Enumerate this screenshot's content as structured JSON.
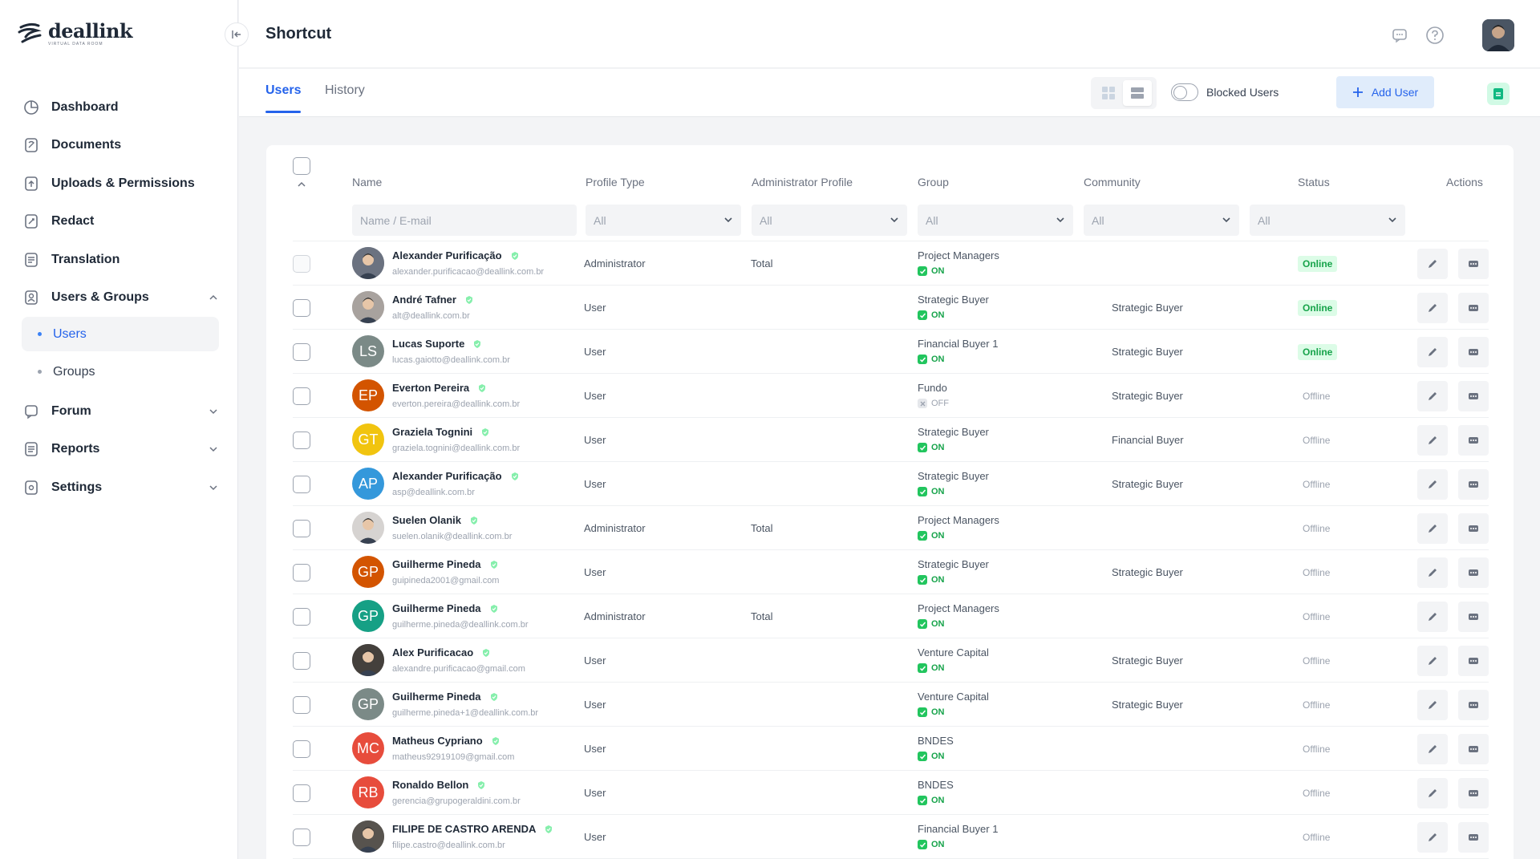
{
  "app": {
    "logo_text": "deallink",
    "logo_subtext": "VIRTUAL DATA ROOM"
  },
  "sidebar": {
    "items": [
      {
        "label": "Dashboard",
        "icon": "dashboard-icon"
      },
      {
        "label": "Documents",
        "icon": "documents-icon"
      },
      {
        "label": "Uploads & Permissions",
        "icon": "upload-icon"
      },
      {
        "label": "Redact",
        "icon": "redact-icon"
      },
      {
        "label": "Translation",
        "icon": "translation-icon"
      },
      {
        "label": "Users & Groups",
        "icon": "users-icon",
        "expanded": true
      },
      {
        "label": "Forum",
        "icon": "forum-icon"
      },
      {
        "label": "Reports",
        "icon": "reports-icon"
      },
      {
        "label": "Settings",
        "icon": "settings-icon"
      }
    ],
    "subitems": [
      {
        "label": "Users",
        "active": true
      },
      {
        "label": "Groups",
        "active": false
      }
    ]
  },
  "header": {
    "title": "Shortcut"
  },
  "tabs": [
    {
      "label": "Users",
      "active": true
    },
    {
      "label": "History",
      "active": false
    }
  ],
  "toolbar": {
    "blocked_users_label": "Blocked Users",
    "add_user_label": "Add User"
  },
  "table": {
    "columns": {
      "name": "Name",
      "profile_type": "Profile Type",
      "admin_profile": "Administrator Profile",
      "group": "Group",
      "community": "Community",
      "status": "Status",
      "actions": "Actions"
    },
    "filters": {
      "name_placeholder": "Name / E-mail",
      "profile_type": "All",
      "admin_profile": "All",
      "group": "All",
      "community": "All",
      "status": "All"
    },
    "rows": [
      {
        "name": "Alexander Purificação",
        "email": "alexander.purificacao@deallink.com.br",
        "avatar": "photo",
        "initials": "",
        "avatar_color": "#6b7280",
        "profile": "Administrator",
        "admin": "Total",
        "group": "Project Managers",
        "group_state": "ON",
        "community": "",
        "status": "Online"
      },
      {
        "name": "André Tafner",
        "email": "alt@deallink.com.br",
        "avatar": "photo",
        "initials": "",
        "avatar_color": "#a8a29e",
        "profile": "User",
        "admin": "",
        "group": "Strategic Buyer",
        "group_state": "ON",
        "community": "Strategic Buyer",
        "status": "Online"
      },
      {
        "name": "Lucas Suporte",
        "email": "lucas.gaiotto@deallink.com.br",
        "avatar": "initials",
        "initials": "LS",
        "avatar_color": "#7b8a87",
        "profile": "User",
        "admin": "",
        "group": "Financial Buyer 1",
        "group_state": "ON",
        "community": "Strategic Buyer",
        "status": "Online"
      },
      {
        "name": "Everton Pereira",
        "email": "everton.pereira@deallink.com.br",
        "avatar": "initials",
        "initials": "EP",
        "avatar_color": "#d35400",
        "profile": "User",
        "admin": "",
        "group": "Fundo",
        "group_state": "OFF",
        "community": "Strategic Buyer",
        "status": "Offline"
      },
      {
        "name": "Graziela Tognini",
        "email": "graziela.tognini@deallink.com.br",
        "avatar": "initials",
        "initials": "GT",
        "avatar_color": "#f1c40f",
        "profile": "User",
        "admin": "",
        "group": "Strategic Buyer",
        "group_state": "ON",
        "community": "Financial Buyer",
        "status": "Offline"
      },
      {
        "name": "Alexander Purificação",
        "email": "asp@deallink.com.br",
        "avatar": "initials",
        "initials": "AP",
        "avatar_color": "#3498db",
        "profile": "User",
        "admin": "",
        "group": "Strategic Buyer",
        "group_state": "ON",
        "community": "Strategic Buyer",
        "status": "Offline"
      },
      {
        "name": "Suelen Olanik",
        "email": "suelen.olanik@deallink.com.br",
        "avatar": "photo",
        "initials": "",
        "avatar_color": "#d6d3d1",
        "profile": "Administrator",
        "admin": "Total",
        "group": "Project Managers",
        "group_state": "ON",
        "community": "",
        "status": "Offline"
      },
      {
        "name": "Guilherme Pineda",
        "email": "guipineda2001@gmail.com",
        "avatar": "initials",
        "initials": "GP",
        "avatar_color": "#d35400",
        "profile": "User",
        "admin": "",
        "group": "Strategic Buyer",
        "group_state": "ON",
        "community": "Strategic Buyer",
        "status": "Offline"
      },
      {
        "name": "Guilherme Pineda",
        "email": "guilherme.pineda@deallink.com.br",
        "avatar": "initials",
        "initials": "GP",
        "avatar_color": "#16a085",
        "profile": "Administrator",
        "admin": "Total",
        "group": "Project Managers",
        "group_state": "ON",
        "community": "",
        "status": "Offline"
      },
      {
        "name": "Alex Purificacao",
        "email": "alexandre.purificacao@gmail.com",
        "avatar": "photo",
        "initials": "",
        "avatar_color": "#44403c",
        "profile": "User",
        "admin": "",
        "group": "Venture Capital",
        "group_state": "ON",
        "community": "Strategic Buyer",
        "status": "Offline"
      },
      {
        "name": "Guilherme Pineda",
        "email": "guilherme.pineda+1@deallink.com.br",
        "avatar": "initials",
        "initials": "GP",
        "avatar_color": "#7b8a87",
        "profile": "User",
        "admin": "",
        "group": "Venture Capital",
        "group_state": "ON",
        "community": "Strategic Buyer",
        "status": "Offline"
      },
      {
        "name": "Matheus Cypriano",
        "email": "matheus92919109@gmail.com",
        "avatar": "initials",
        "initials": "MC",
        "avatar_color": "#e74c3c",
        "profile": "User",
        "admin": "",
        "group": "BNDES",
        "group_state": "ON",
        "community": "",
        "status": "Offline"
      },
      {
        "name": "Ronaldo Bellon",
        "email": "gerencia@grupogeraldini.com.br",
        "avatar": "initials",
        "initials": "RB",
        "avatar_color": "#e74c3c",
        "profile": "User",
        "admin": "",
        "group": "BNDES",
        "group_state": "ON",
        "community": "",
        "status": "Offline"
      },
      {
        "name": "FILIPE DE CASTRO ARENDA",
        "email": "filipe.castro@deallink.com.br",
        "avatar": "photo",
        "initials": "",
        "avatar_color": "#57534e",
        "profile": "User",
        "admin": "",
        "group": "Financial Buyer 1",
        "group_state": "ON",
        "community": "",
        "status": "Offline"
      }
    ]
  },
  "colors": {
    "accent": "#2563eb",
    "online_bg": "#dcfce7",
    "online_text": "#16a34a",
    "offline_text": "#9ca3af"
  }
}
